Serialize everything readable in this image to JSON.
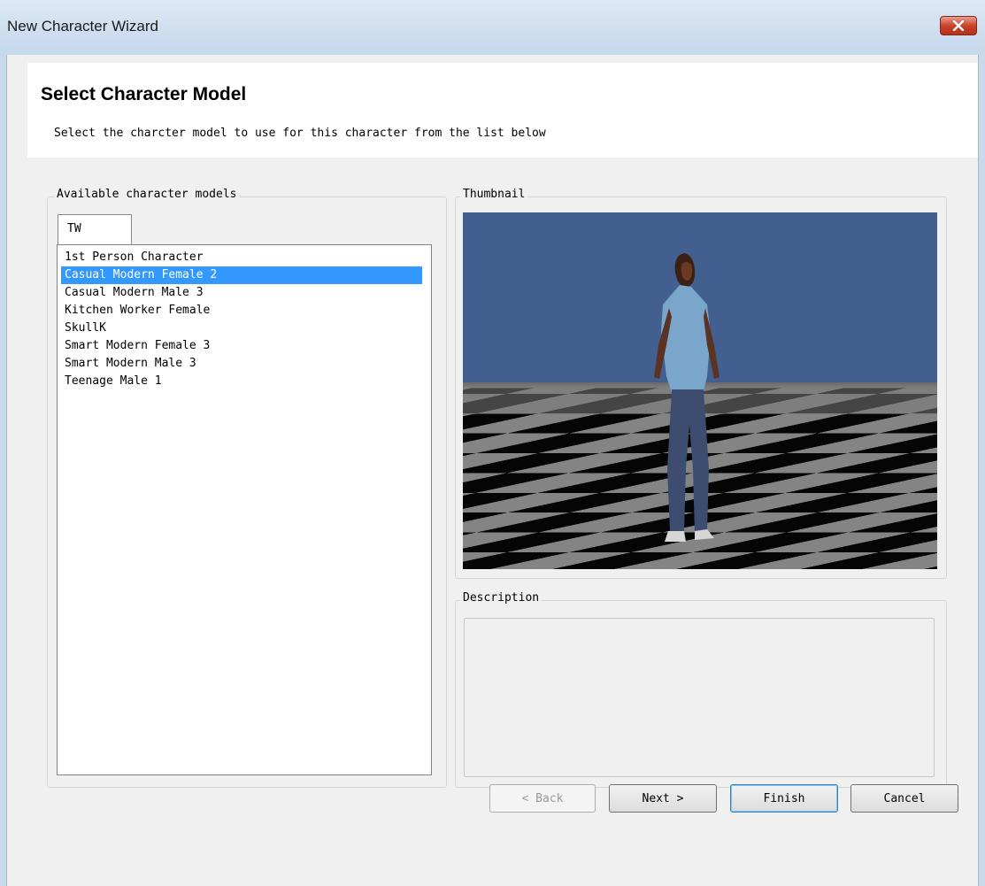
{
  "window": {
    "title": "New Character Wizard",
    "close_icon": "close-icon"
  },
  "header": {
    "title": "Select Character Model",
    "subtitle": "Select the charcter model to use for this character from the list below"
  },
  "models_group": {
    "label": "Available character models",
    "tab": "TW",
    "items": [
      "1st Person Character",
      "Casual Modern Female 2",
      "Casual Modern Male 3",
      "Kitchen Worker Female",
      "SkullK",
      "Smart Modern Female 3",
      "Smart Modern Male 3",
      "Teenage Male 1"
    ],
    "selected": "Casual Modern Female 2"
  },
  "thumbnail_group": {
    "label": "Thumbnail"
  },
  "description_group": {
    "label": "Description",
    "text": ""
  },
  "buttons": {
    "back": "< Back",
    "next": "Next >",
    "finish": "Finish",
    "cancel": "Cancel"
  },
  "colors": {
    "selection": "#3399ff",
    "sky": "#425f8f",
    "close_button": "#c8432b"
  }
}
